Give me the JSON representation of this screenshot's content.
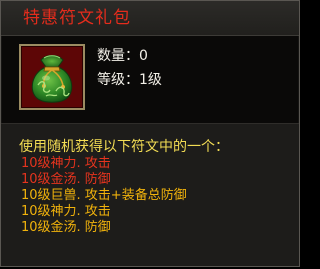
{
  "item": {
    "title": "特惠符文礼包",
    "icon": "money-bag-icon",
    "quantity_text": "数量：0",
    "level_text": "等级：1级"
  },
  "description": {
    "heading": "使用随机获得以下符文中的一个：",
    "runes": [
      {
        "text": "10级神力. 攻击",
        "color": "#e5341e"
      },
      {
        "text": "10级金汤. 防御",
        "color": "#e5341e"
      },
      {
        "text": "10级巨兽. 攻击+装备总防御",
        "color": "#f0b20c"
      },
      {
        "text": "10级神力. 攻击",
        "color": "#f0b20c"
      },
      {
        "text": "10级金汤. 防御",
        "color": "#f0b20c"
      }
    ]
  },
  "colors": {
    "title": "#e52c1c",
    "heading": "#f2dc54",
    "icon_background": "#5d0606",
    "icon_border": "#9b8c62"
  }
}
